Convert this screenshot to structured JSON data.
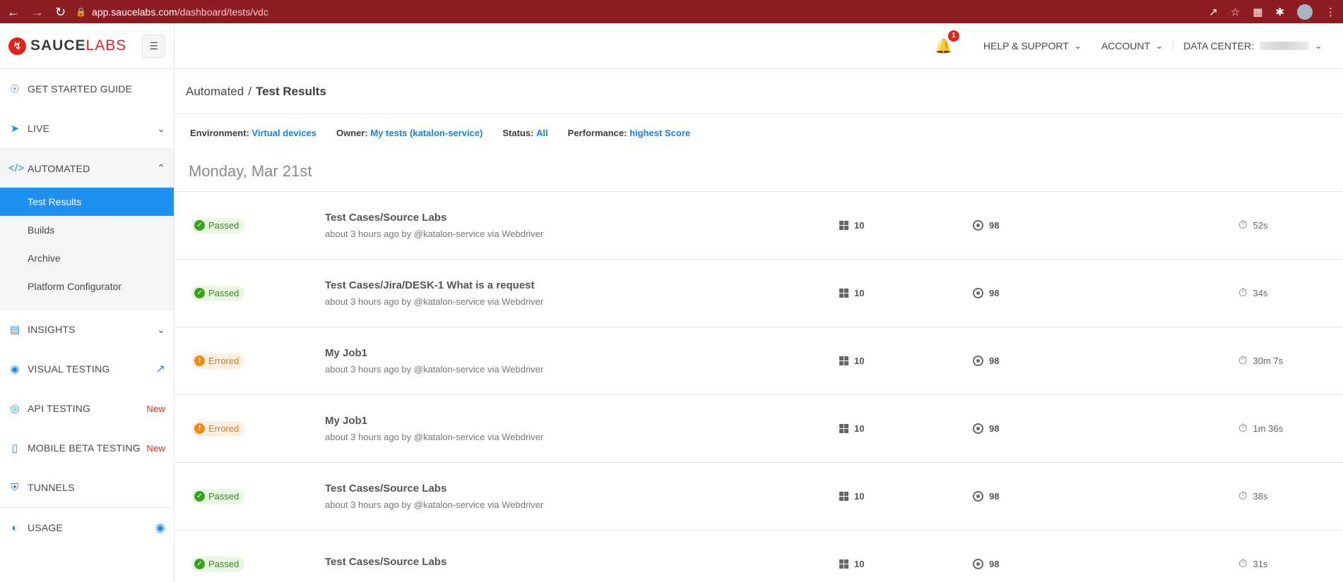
{
  "browser": {
    "url_host": "app.saucelabs.com",
    "url_path": "/dashboard/tests/vdc"
  },
  "brand": {
    "name_bold": "SAUCE",
    "name_light": "LABS"
  },
  "sidebar": {
    "items": [
      {
        "label": "GET STARTED GUIDE",
        "icon": "lightbulb-icon"
      },
      {
        "label": "LIVE",
        "icon": "cursor-icon"
      },
      {
        "label": "AUTOMATED",
        "icon": "code-icon"
      },
      {
        "label": "INSIGHTS",
        "icon": "bar-chart-icon"
      },
      {
        "label": "VISUAL TESTING",
        "icon": "camera-icon"
      },
      {
        "label": "API TESTING",
        "icon": "api-icon",
        "badge": "New"
      },
      {
        "label": "MOBILE BETA TESTING",
        "icon": "mobile-icon",
        "badge": "New"
      },
      {
        "label": "TUNNELS",
        "icon": "shield-icon"
      },
      {
        "label": "USAGE",
        "icon": "gauge-icon"
      }
    ],
    "automated_sub": [
      "Test Results",
      "Builds",
      "Archive",
      "Platform Configurator"
    ]
  },
  "header": {
    "notification_count": "1",
    "help": "HELP & SUPPORT",
    "account": "ACCOUNT",
    "data_center": "DATA CENTER:"
  },
  "breadcrumb": {
    "parent": "Automated",
    "separator": "/",
    "current": "Test Results"
  },
  "filters": [
    {
      "label": "Environment:",
      "value": "Virtual devices"
    },
    {
      "label": "Owner:",
      "value": "My tests (katalon-service)"
    },
    {
      "label": "Status:",
      "value": "All"
    },
    {
      "label": "Performance:",
      "value": "highest Score"
    }
  ],
  "date_heading": "Monday, Mar 21st",
  "tests": [
    {
      "status": "Passed",
      "name": "Test Cases/Source Labs",
      "meta": "about 3 hours ago by @katalon-service via Webdriver",
      "os": "10",
      "browser": "98",
      "duration": "52s"
    },
    {
      "status": "Passed",
      "name": "Test Cases/Jira/DESK-1 What is a request",
      "meta": "about 3 hours ago by @katalon-service via Webdriver",
      "os": "10",
      "browser": "98",
      "duration": "34s"
    },
    {
      "status": "Errored",
      "name": "My Job1",
      "meta": "about 3 hours ago by @katalon-service via Webdriver",
      "os": "10",
      "browser": "98",
      "duration": "30m 7s"
    },
    {
      "status": "Errored",
      "name": "My Job1",
      "meta": "about 3 hours ago by @katalon-service via Webdriver",
      "os": "10",
      "browser": "98",
      "duration": "1m 36s"
    },
    {
      "status": "Passed",
      "name": "Test Cases/Source Labs",
      "meta": "about 3 hours ago by @katalon-service via Webdriver",
      "os": "10",
      "browser": "98",
      "duration": "38s"
    },
    {
      "status": "Passed",
      "name": "Test Cases/Source Labs",
      "meta": "",
      "os": "10",
      "browser": "98",
      "duration": "31s"
    }
  ]
}
